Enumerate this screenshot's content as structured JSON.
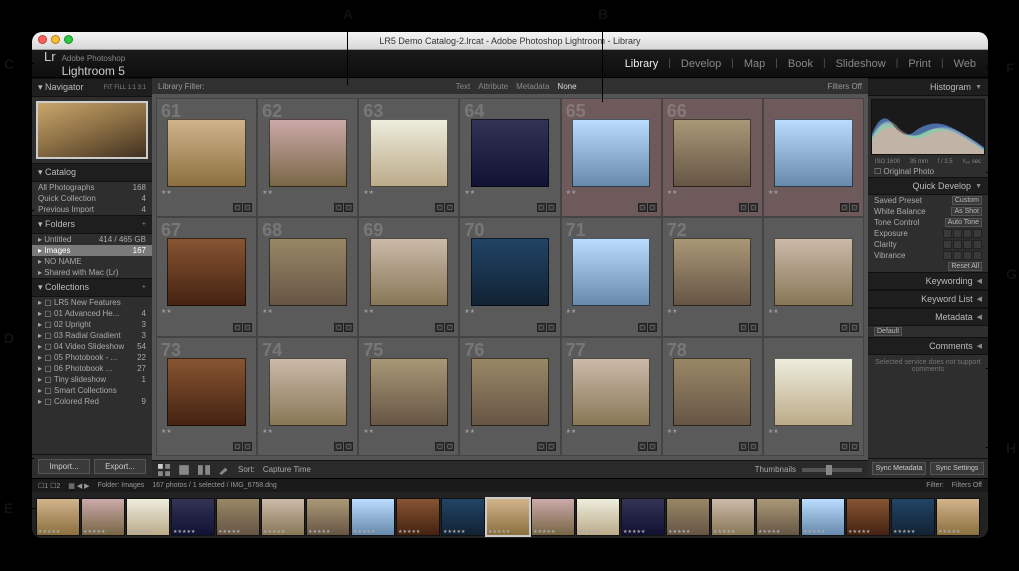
{
  "callouts": {
    "A": "A",
    "B": "B",
    "C": "C",
    "D": "D",
    "E": "E",
    "F": "F",
    "G": "G",
    "H": "H"
  },
  "titlebar": "LR5 Demo Catalog-2.lrcat - Adobe Photoshop Lightroom - Library",
  "brand": {
    "lr": "Lr",
    "sub": "Adobe Photoshop",
    "name": "Lightroom 5"
  },
  "modules": [
    {
      "label": "Library",
      "active": true
    },
    {
      "label": "Develop",
      "active": false
    },
    {
      "label": "Map",
      "active": false
    },
    {
      "label": "Book",
      "active": false
    },
    {
      "label": "Slideshow",
      "active": false
    },
    {
      "label": "Print",
      "active": false
    },
    {
      "label": "Web",
      "active": false
    }
  ],
  "navigator": {
    "title": "Navigator",
    "modes": "FIT  FILL  1:1  3:1"
  },
  "catalog": {
    "title": "Catalog",
    "rows": [
      {
        "label": "All Photographs",
        "count": "168"
      },
      {
        "label": "Quick Collection",
        "count": "4"
      },
      {
        "label": "Previous Import",
        "count": "4"
      }
    ]
  },
  "folders": {
    "title": "Folders",
    "rows": [
      {
        "label": "Untitled",
        "count": "414 / 465 GB",
        "sel": false
      },
      {
        "label": "Images",
        "count": "167",
        "sel": true
      },
      {
        "label": "NO NAME",
        "count": "",
        "sel": false
      },
      {
        "label": "Shared with Mac (Lr)",
        "count": "",
        "sel": false
      }
    ]
  },
  "collections": {
    "title": "Collections",
    "rows": [
      {
        "label": "LR5 New Features",
        "count": ""
      },
      {
        "label": "01 Advanced He...",
        "count": "4"
      },
      {
        "label": "02 Upright",
        "count": "3"
      },
      {
        "label": "03 Radial Gradient",
        "count": "3"
      },
      {
        "label": "04 Video Slideshow",
        "count": "54"
      },
      {
        "label": "05 Photobook - ...",
        "count": "22"
      },
      {
        "label": "06 Photobook ...",
        "count": "27"
      },
      {
        "label": "Tiny slideshow",
        "count": "1"
      },
      {
        "label": "Smart Collections",
        "count": ""
      },
      {
        "label": "Colored Red",
        "count": "9"
      }
    ]
  },
  "import_label": "Import...",
  "export_label": "Export...",
  "library_filter": {
    "title": "Library Filter:",
    "tabs": [
      "Text",
      "Attribute",
      "Metadata",
      "None"
    ],
    "active": "None",
    "right": "Filters Off"
  },
  "toolbar": {
    "sort_label": "Sort:",
    "sort_value": "Capture Time",
    "thumbs_label": "Thumbnails"
  },
  "grid": [
    {
      "n": "61",
      "v": "t1"
    },
    {
      "n": "62",
      "v": "t2"
    },
    {
      "n": "63",
      "v": "t3"
    },
    {
      "n": "64",
      "v": "t4"
    },
    {
      "n": "65",
      "v": "t8",
      "tint": true
    },
    {
      "n": "66",
      "v": "t7",
      "tint": true
    },
    {
      "n": "",
      "v": "t8",
      "tint": true
    },
    {
      "n": "67",
      "v": "t9"
    },
    {
      "n": "68",
      "v": "t5"
    },
    {
      "n": "69",
      "v": "t6"
    },
    {
      "n": "70",
      "v": "t10"
    },
    {
      "n": "71",
      "v": "t8"
    },
    {
      "n": "72",
      "v": "t7"
    },
    {
      "n": "",
      "v": "t6"
    },
    {
      "n": "73",
      "v": "t9"
    },
    {
      "n": "74",
      "v": "t6"
    },
    {
      "n": "75",
      "v": "t7"
    },
    {
      "n": "76",
      "v": "t5"
    },
    {
      "n": "77",
      "v": "t6"
    },
    {
      "n": "78",
      "v": "t5"
    },
    {
      "n": "",
      "v": "t3"
    }
  ],
  "histogram": {
    "title": "Histogram",
    "meta": [
      "ISO 1600",
      "35 mm",
      "f / 3.5",
      "¹⁄₈₀ sec"
    ],
    "orig": "Original Photo"
  },
  "quick_develop": {
    "title": "Quick Develop",
    "preset_label": "Saved Preset",
    "preset_value": "Custom",
    "wb_label": "White Balance",
    "wb_value": "As Shot",
    "tone_label": "Tone Control",
    "tone_btn": "Auto Tone",
    "exposure": "Exposure",
    "clarity": "Clarity",
    "vibrance": "Vibrance",
    "reset": "Reset All"
  },
  "right_sections": [
    "Keywording",
    "Keyword List",
    "Metadata",
    "Comments"
  ],
  "metadata_preset": "Default",
  "comments_msg": "Selected service does not support comments",
  "sync": {
    "meta": "Sync Metadata",
    "settings": "Sync Settings"
  },
  "secondary": {
    "folder": "Folder: Images",
    "status": "167 photos / 1 selected / IMG_6758.dng",
    "filter": "Filter:",
    "filters_off": "Filters Off"
  },
  "filmstrip_count": 21
}
